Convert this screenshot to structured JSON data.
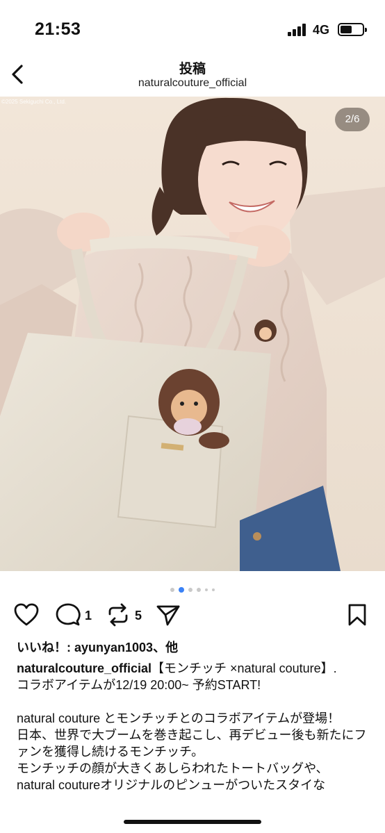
{
  "status_bar": {
    "time": "21:53",
    "network": "4G"
  },
  "header": {
    "title": "投稿",
    "username": "naturalcouture_official"
  },
  "photo": {
    "copyright": "©2025 Sekiguchi Co., Ltd.",
    "counter": "2/6"
  },
  "carousel": {
    "current_index": 2,
    "total_dots": 6
  },
  "actions": {
    "comment_count": "1",
    "repost_count": "5"
  },
  "caption": {
    "likes_prefix": "いいね！: ",
    "likes_user": "ayunyan1003",
    "likes_suffix": "、他",
    "username": "naturalcouture_official",
    "title_text": "【モンチッチ ×natural couture】.",
    "line1": "コラボアイテムが12/19 20:00~ 予約START!",
    "line2": "natural couture とモンチッチとのコラボアイテムが登場！",
    "line3": "日本、世界で大ブームを巻き起こし、再デビュー後も新たにファンを獲得し続けるモンチッチ。",
    "line4": "モンチッチの顔が大きくあしらわれたトートバッグや、",
    "line5": "natural coutureオリジナルのピンューがついたスタイな"
  },
  "icons": {
    "back": "chevron-left-icon",
    "like": "heart-icon",
    "comment": "comment-bubble-icon",
    "repost": "repost-arrows-icon",
    "share": "send-icon",
    "save": "bookmark-icon"
  }
}
